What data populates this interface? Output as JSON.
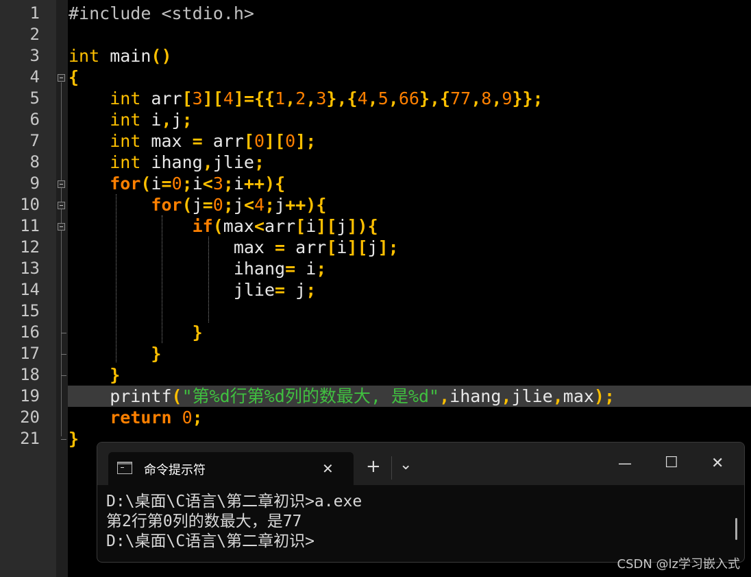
{
  "editor": {
    "line_numbers": [
      "1",
      "2",
      "3",
      "4",
      "5",
      "6",
      "7",
      "8",
      "9",
      "10",
      "11",
      "12",
      "13",
      "14",
      "15",
      "16",
      "17",
      "18",
      "19",
      "20",
      "21"
    ],
    "lines": [
      [
        {
          "t": "#include <stdio.h>",
          "c": "pp"
        }
      ],
      [],
      [
        {
          "t": "int",
          "c": "kw"
        },
        {
          "t": " main"
        },
        {
          "t": "()",
          "c": "op"
        }
      ],
      [
        {
          "t": "{",
          "c": "op"
        }
      ],
      [
        {
          "t": "    "
        },
        {
          "t": "int",
          "c": "kw"
        },
        {
          "t": " arr"
        },
        {
          "t": "[",
          "c": "op"
        },
        {
          "t": "3",
          "c": "nm"
        },
        {
          "t": "][",
          "c": "op"
        },
        {
          "t": "4",
          "c": "nm"
        },
        {
          "t": "]={{",
          "c": "op"
        },
        {
          "t": "1",
          "c": "nm"
        },
        {
          "t": ",",
          "c": "op"
        },
        {
          "t": "2",
          "c": "nm"
        },
        {
          "t": ",",
          "c": "op"
        },
        {
          "t": "3",
          "c": "nm"
        },
        {
          "t": "},{",
          "c": "op"
        },
        {
          "t": "4",
          "c": "nm"
        },
        {
          "t": ",",
          "c": "op"
        },
        {
          "t": "5",
          "c": "nm"
        },
        {
          "t": ",",
          "c": "op"
        },
        {
          "t": "66",
          "c": "nm"
        },
        {
          "t": "},{",
          "c": "op"
        },
        {
          "t": "77",
          "c": "nm"
        },
        {
          "t": ",",
          "c": "op"
        },
        {
          "t": "8",
          "c": "nm"
        },
        {
          "t": ",",
          "c": "op"
        },
        {
          "t": "9",
          "c": "nm"
        },
        {
          "t": "}};",
          "c": "op"
        }
      ],
      [
        {
          "t": "    "
        },
        {
          "t": "int",
          "c": "kw"
        },
        {
          "t": " i"
        },
        {
          "t": ",",
          "c": "op"
        },
        {
          "t": "j"
        },
        {
          "t": ";",
          "c": "op"
        }
      ],
      [
        {
          "t": "    "
        },
        {
          "t": "int",
          "c": "kw"
        },
        {
          "t": " max "
        },
        {
          "t": "=",
          "c": "op"
        },
        {
          "t": " arr"
        },
        {
          "t": "[",
          "c": "op"
        },
        {
          "t": "0",
          "c": "nm"
        },
        {
          "t": "][",
          "c": "op"
        },
        {
          "t": "0",
          "c": "nm"
        },
        {
          "t": "];",
          "c": "op"
        }
      ],
      [
        {
          "t": "    "
        },
        {
          "t": "int",
          "c": "kw"
        },
        {
          "t": " ihang"
        },
        {
          "t": ",",
          "c": "op"
        },
        {
          "t": "jlie"
        },
        {
          "t": ";",
          "c": "op"
        }
      ],
      [
        {
          "t": "    "
        },
        {
          "t": "for",
          "c": "kr"
        },
        {
          "t": "(",
          "c": "op"
        },
        {
          "t": "i"
        },
        {
          "t": "=",
          "c": "op"
        },
        {
          "t": "0",
          "c": "nm"
        },
        {
          "t": ";",
          "c": "op"
        },
        {
          "t": "i"
        },
        {
          "t": "<",
          "c": "op"
        },
        {
          "t": "3",
          "c": "nm"
        },
        {
          "t": ";",
          "c": "op"
        },
        {
          "t": "i"
        },
        {
          "t": "++){",
          "c": "op"
        }
      ],
      [
        {
          "t": "        "
        },
        {
          "t": "for",
          "c": "kr"
        },
        {
          "t": "(",
          "c": "op"
        },
        {
          "t": "j"
        },
        {
          "t": "=",
          "c": "op"
        },
        {
          "t": "0",
          "c": "nm"
        },
        {
          "t": ";",
          "c": "op"
        },
        {
          "t": "j"
        },
        {
          "t": "<",
          "c": "op"
        },
        {
          "t": "4",
          "c": "nm"
        },
        {
          "t": ";",
          "c": "op"
        },
        {
          "t": "j"
        },
        {
          "t": "++){",
          "c": "op"
        }
      ],
      [
        {
          "t": "            "
        },
        {
          "t": "if",
          "c": "kr"
        },
        {
          "t": "(",
          "c": "op"
        },
        {
          "t": "max"
        },
        {
          "t": "<",
          "c": "op"
        },
        {
          "t": "arr"
        },
        {
          "t": "[",
          "c": "op"
        },
        {
          "t": "i"
        },
        {
          "t": "][",
          "c": "op"
        },
        {
          "t": "j"
        },
        {
          "t": "])",
          "c": "op"
        },
        {
          "t": "{",
          "c": "op"
        }
      ],
      [
        {
          "t": "                max "
        },
        {
          "t": "=",
          "c": "op"
        },
        {
          "t": " arr"
        },
        {
          "t": "[",
          "c": "op"
        },
        {
          "t": "i"
        },
        {
          "t": "][",
          "c": "op"
        },
        {
          "t": "j"
        },
        {
          "t": "];",
          "c": "op"
        }
      ],
      [
        {
          "t": "                ihang"
        },
        {
          "t": "=",
          "c": "op"
        },
        {
          "t": " i"
        },
        {
          "t": ";",
          "c": "op"
        }
      ],
      [
        {
          "t": "                jlie"
        },
        {
          "t": "=",
          "c": "op"
        },
        {
          "t": " j"
        },
        {
          "t": ";",
          "c": "op"
        }
      ],
      [],
      [
        {
          "t": "            "
        },
        {
          "t": "}",
          "c": "op"
        }
      ],
      [
        {
          "t": "        "
        },
        {
          "t": "}",
          "c": "op"
        }
      ],
      [
        {
          "t": "    "
        },
        {
          "t": "}",
          "c": "op"
        }
      ],
      [
        {
          "t": "    printf"
        },
        {
          "t": "(",
          "c": "op"
        },
        {
          "t": "\"第%d行第%d列的数最大, 是%d\"",
          "c": "st"
        },
        {
          "t": ",",
          "c": "op"
        },
        {
          "t": "ihang"
        },
        {
          "t": ",",
          "c": "op"
        },
        {
          "t": "jlie"
        },
        {
          "t": ",",
          "c": "op"
        },
        {
          "t": "max"
        },
        {
          "t": ");",
          "c": "op"
        }
      ],
      [
        {
          "t": "    "
        },
        {
          "t": "return",
          "c": "kr"
        },
        {
          "t": " "
        },
        {
          "t": "0",
          "c": "nm"
        },
        {
          "t": ";",
          "c": "op"
        }
      ],
      [
        {
          "t": "}",
          "c": "op"
        }
      ]
    ]
  },
  "terminal": {
    "tab_title": "命令提示符",
    "tab_icon": "cmd-icon",
    "close_tab_symbol": "✕",
    "new_tab_symbol": "+",
    "dropdown_symbol": "⌄",
    "minimize_symbol": "—",
    "maximize_symbol": "☐",
    "close_window_symbol": "✕",
    "output": "D:\\桌面\\C语言\\第二章初识>a.exe\n第2行第0列的数最大，是77\nD:\\桌面\\C语言\\第二章初识>"
  },
  "watermark": "CSDN @lz学习嵌入式"
}
